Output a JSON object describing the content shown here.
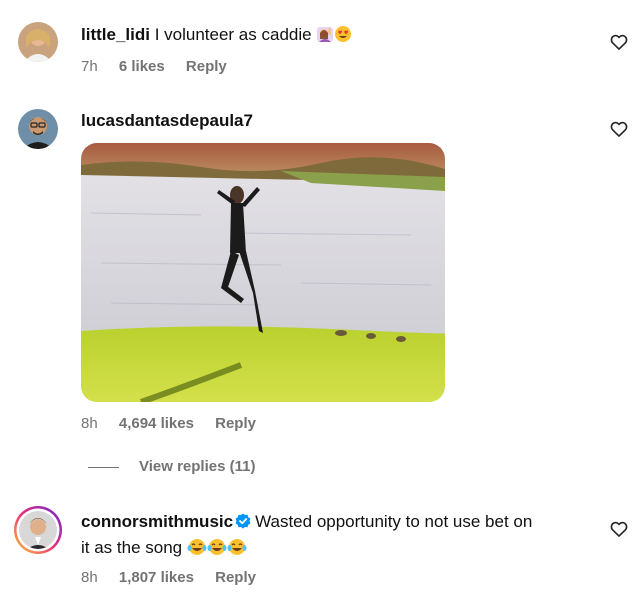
{
  "comments": [
    {
      "username": "little_lidi",
      "text": "I volunteer as caddie",
      "emojis": [
        "woman-raising-hand-emoji",
        "heart-eyes-emoji"
      ],
      "time": "7h",
      "likes": "6 likes",
      "reply": "Reply"
    },
    {
      "username": "lucasdantasdepaula7",
      "text": "",
      "attachment": "gif-woman-jumping-by-lake",
      "time": "8h",
      "likes": "4,694 likes",
      "reply": "Reply",
      "view_replies": "View replies (11)"
    },
    {
      "username": "connorsmithmusic",
      "verified": true,
      "text_line1": "Wasted opportunity to not use bet on",
      "text_line2": "it as the song",
      "emojis": [
        "tears-of-joy-emoji",
        "tears-of-joy-emoji",
        "tears-of-joy-emoji"
      ],
      "time": "8h",
      "likes": "1,807 likes",
      "reply": "Reply"
    }
  ],
  "colors": {
    "meta_text": "#737373",
    "verified_badge": "#0095f6",
    "story_ring_start": "#f9ce34",
    "story_ring_end": "#ee2a7b"
  }
}
